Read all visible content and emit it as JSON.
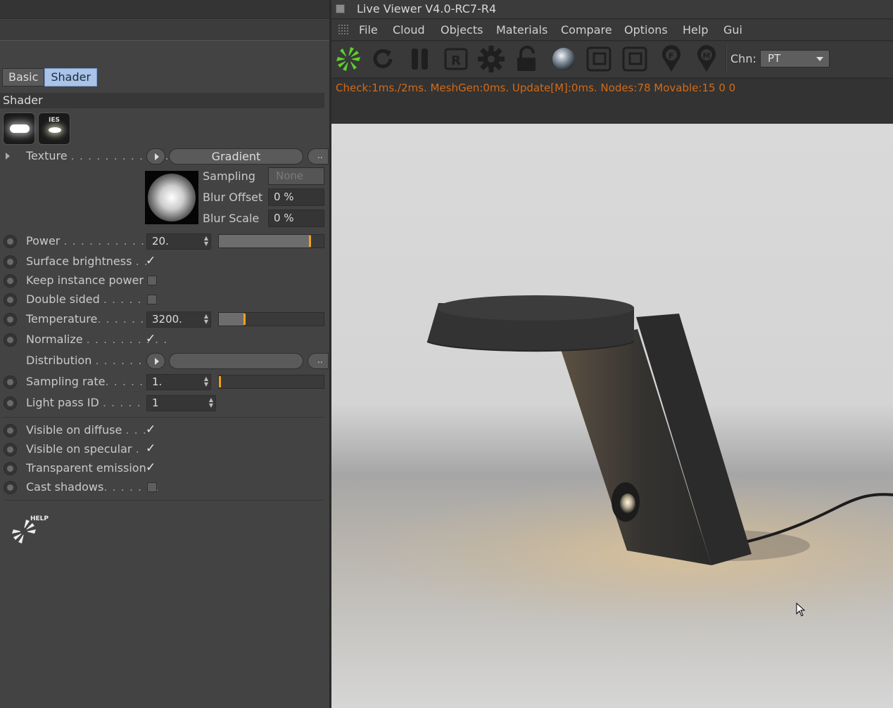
{
  "tabs": [
    "Basic",
    "Shader"
  ],
  "section_title": "Shader",
  "shader_modes": [
    {
      "icon": "area-light-icon"
    },
    {
      "icon": "ies-light-icon",
      "label": "IES"
    }
  ],
  "texture": {
    "label": "Texture",
    "value": "Gradient",
    "more": "..",
    "sampling_label": "Sampling",
    "sampling_value": "None",
    "blur_offset_label": "Blur Offset",
    "blur_offset_value": "0 %",
    "blur_scale_label": "Blur Scale",
    "blur_scale_value": "0 %"
  },
  "power": {
    "label": "Power",
    "value": "20.",
    "slider_fraction": 0.88
  },
  "surface_brightness": {
    "label": "Surface brightness",
    "checked": true
  },
  "keep_instance_power": {
    "label": "Keep instance power",
    "checked": false
  },
  "double_sided": {
    "label": "Double sided",
    "checked": false
  },
  "temperature": {
    "label": "Temperature",
    "value": "3200.",
    "slider_fraction": 0.24
  },
  "normalize": {
    "label": "Normalize",
    "checked": true
  },
  "distribution": {
    "label": "Distribution",
    "more": ".."
  },
  "sampling_rate": {
    "label": "Sampling rate",
    "value": "1.",
    "slider_fraction": 0.0
  },
  "light_pass_id": {
    "label": "Light pass ID",
    "value": "1"
  },
  "visible_on_diffuse": {
    "label": "Visible on diffuse",
    "checked": true
  },
  "visible_on_specular": {
    "label": "Visible on specular",
    "checked": true
  },
  "transparent_emission": {
    "label": "Transparent emission",
    "checked": true
  },
  "cast_shadows": {
    "label": "Cast shadows",
    "checked": false
  },
  "help_label": "HELP",
  "viewer": {
    "title": "Live Viewer V4.0-RC7-R4",
    "menu": [
      "File",
      "Cloud",
      "Objects",
      "Materials",
      "Compare",
      "Options",
      "Help",
      "Gui"
    ],
    "toolbar_icons": [
      "octane-logo-icon",
      "refresh-icon",
      "pause-icon",
      "render-region-icon",
      "settings-gear-icon",
      "lock-icon",
      "material-ball-icon",
      "focus-frame-icon",
      "film-region-icon",
      "focus-pin-icon",
      "material-pin-icon"
    ],
    "channel_label": "Chn:",
    "channel_value": "PT",
    "status": "Check:1ms./2ms. MeshGen:0ms. Update[M]:0ms. Nodes:78 Movable:15  0 0"
  },
  "colors": {
    "accent_orange": "#f2a21c",
    "status_text": "#d26a17",
    "octane_green": "#5bd12d",
    "active_tab": "#a9c4e8"
  }
}
